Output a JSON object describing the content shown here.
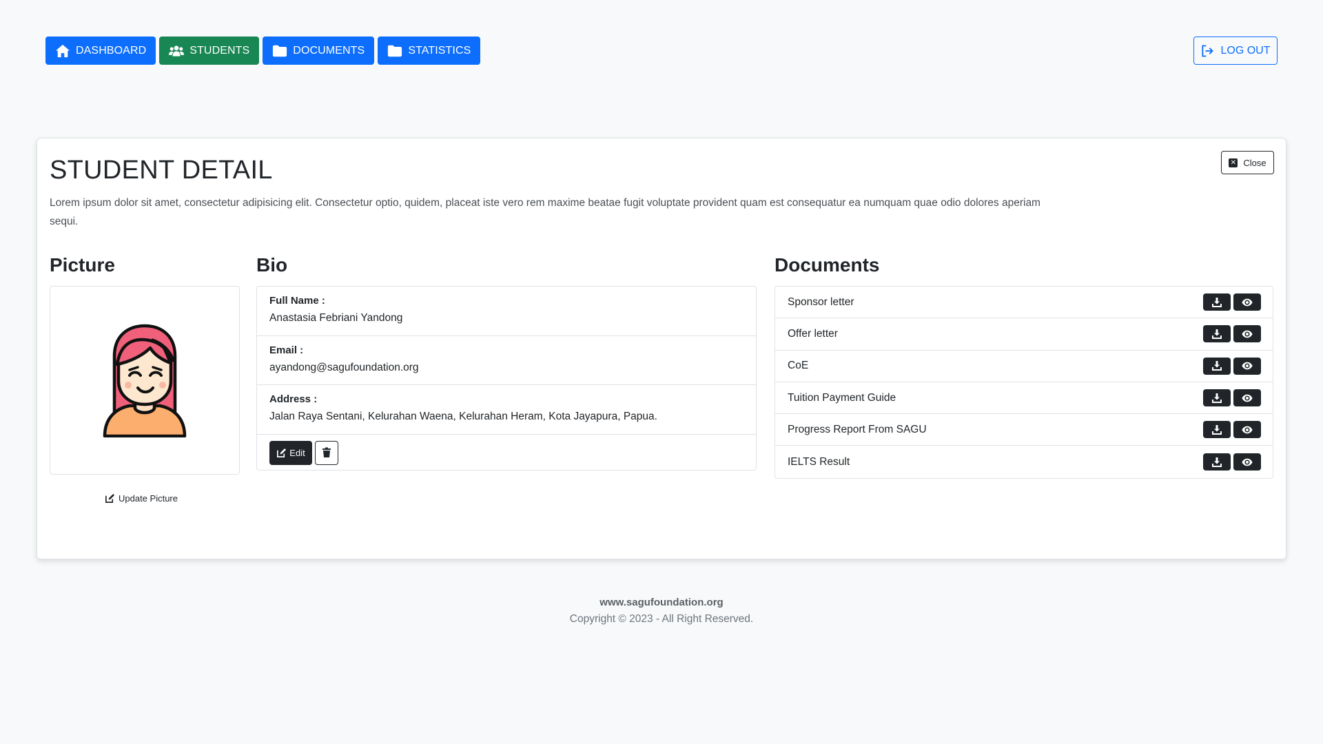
{
  "nav": {
    "items": [
      {
        "label": "DASHBOARD",
        "icon": "home-icon",
        "color": "#0d6efd"
      },
      {
        "label": "STUDENTS",
        "icon": "users-icon",
        "color": "#198754"
      },
      {
        "label": "DOCUMENTS",
        "icon": "folder-icon",
        "color": "#0d6efd"
      },
      {
        "label": "STATISTICS",
        "icon": "folder-icon",
        "color": "#0d6efd"
      }
    ],
    "logout_label": "LOG OUT"
  },
  "detail": {
    "title": "STUDENT DETAIL",
    "description": "Lorem ipsum dolor sit amet, consectetur adipisicing elit. Consectetur optio, quidem, placeat iste vero rem maxime beatae fugit voluptate provident quam est consequatur ea numquam quae odio dolores aperiam sequi.",
    "close_label": "Close"
  },
  "picture": {
    "heading": "Picture",
    "update_label": "Update Picture"
  },
  "bio": {
    "heading": "Bio",
    "fields": [
      {
        "label": "Full Name :",
        "value": "Anastasia Febriani Yandong"
      },
      {
        "label": "Email :",
        "value": "ayandong@sagufoundation.org"
      },
      {
        "label": "Address :",
        "value": "Jalan Raya Sentani, Kelurahan Waena, Kelurahan Heram, Kota Jayapura, Papua."
      }
    ],
    "edit_label": "Edit"
  },
  "documents": {
    "heading": "Documents",
    "items": [
      "Sponsor letter",
      "Offer letter",
      "CoE",
      "Tuition Payment Guide",
      "Progress Report From SAGU",
      "IELTS Result"
    ]
  },
  "footer": {
    "site": "www.sagufoundation.org",
    "copyright": "Copyright © 2023 - All Right Reserved."
  }
}
